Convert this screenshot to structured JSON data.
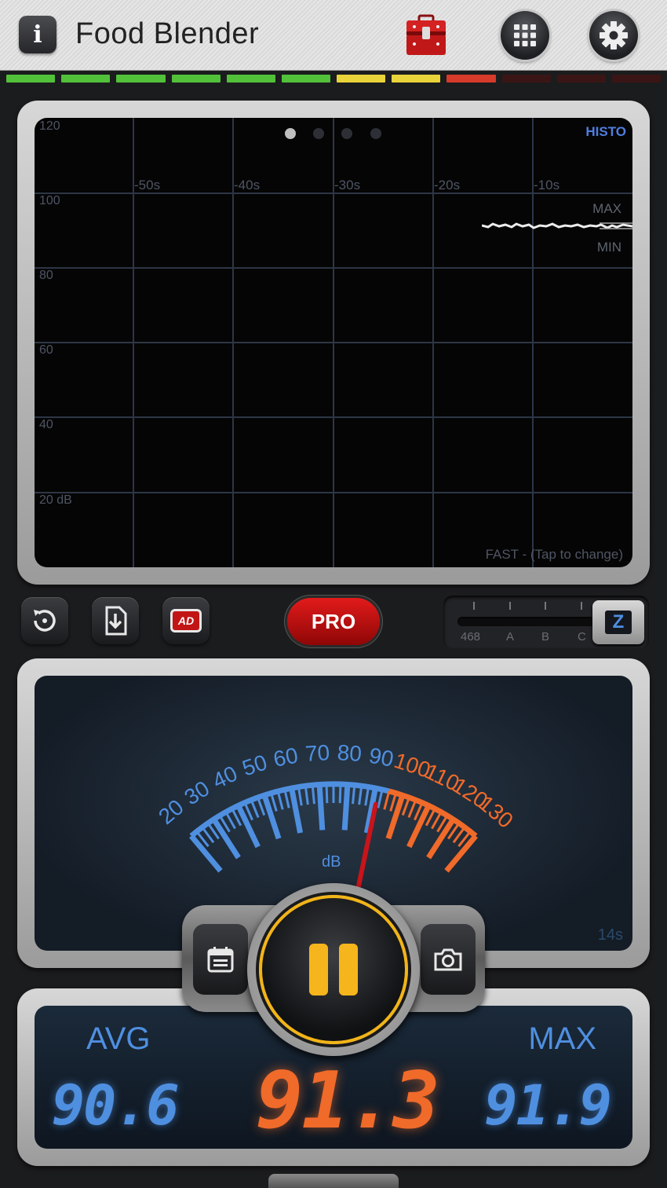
{
  "header": {
    "info_label": "i",
    "title": "Food Blender",
    "icons": [
      "info-icon",
      "toolbox-icon",
      "app-grid-icon",
      "gear-icon"
    ]
  },
  "level_bar": {
    "segments": [
      "#52c13a",
      "#52c13a",
      "#52c13a",
      "#52c13a",
      "#52c13a",
      "#52c13a",
      "#e8d33a",
      "#e8d33a",
      "#d63a2a",
      "#3a1515",
      "#3a1515",
      "#3a1515"
    ]
  },
  "history": {
    "mode_label": "HISTO",
    "y_labels": [
      "120",
      "100",
      "80",
      "60",
      "40",
      "20 dB"
    ],
    "x_labels": [
      "-50s",
      "-40s",
      "-30s",
      "-20s",
      "-10s"
    ],
    "max_label": "MAX",
    "min_label": "MIN",
    "response_label": "FAST - (Tap to change)",
    "page_count": 4,
    "active_page": 1
  },
  "controls": {
    "pro_label": "PRO",
    "ad_label": "AD",
    "weight_labels": [
      "468",
      "A",
      "B",
      "C"
    ],
    "weight_selected": "Z"
  },
  "meter": {
    "scale_labels": [
      "20",
      "30",
      "40",
      "50",
      "60",
      "70",
      "80",
      "90",
      "100",
      "110",
      "120",
      "130"
    ],
    "unit": "dB",
    "elapsed": "14s",
    "needle_value": 91.3,
    "colors": {
      "low": "#4f8fe0",
      "high": "#f06a2a",
      "needle": "#c8141a"
    }
  },
  "readout": {
    "avg_label": "AVG",
    "avg_value": "90.6",
    "current_value": "91.3",
    "max_label": "MAX",
    "max_value": "91.9"
  }
}
